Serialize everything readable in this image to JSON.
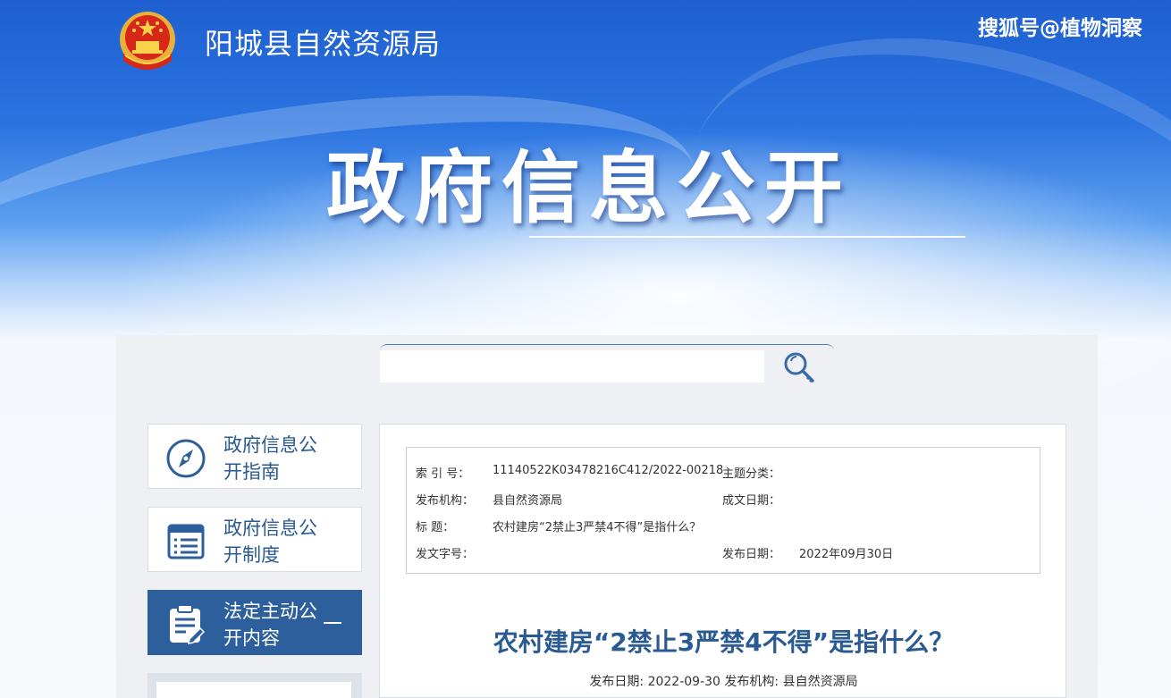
{
  "header": {
    "site_title": "阳城县自然资源局",
    "watermark": "搜狐号@植物洞察",
    "hero_title": "政府信息公开"
  },
  "search": {
    "placeholder": "",
    "button_icon": "search-key-icon"
  },
  "sidebar": {
    "items": [
      {
        "label": "政府信息公开指南",
        "icon": "compass-icon",
        "active": false
      },
      {
        "label": "政府信息公开制度",
        "icon": "document-list-icon",
        "active": false
      },
      {
        "label": "法定主动公开内容",
        "icon": "clipboard-edit-icon",
        "active": true
      }
    ]
  },
  "meta": {
    "index_label": "索  引  号：",
    "index_value": "11140522K03478216C412/2022-00218",
    "topic_label": "主题分类：",
    "topic_value": "",
    "publisher_label": "发布机构：",
    "publisher_value": "县自然资源局",
    "written_label": "成文日期：",
    "written_value": "",
    "title_label": "标       题：",
    "title_value": "农村建房“2禁止3严禁4不得”是指什么？",
    "docno_label": "发文字号：",
    "docno_value": "",
    "pubdate_label": "发布日期：",
    "pubdate_value": "2022年09月30日"
  },
  "article": {
    "title": "农村建房“2禁止3严禁4不得”是指什么？",
    "meta_line": "发布日期: 2022-09-30 发布机构: 县自然资源局"
  },
  "colors": {
    "banner_blue": "#1e5fd0",
    "accent_blue": "#2c5f9c",
    "title_blue": "#2a5a92"
  }
}
